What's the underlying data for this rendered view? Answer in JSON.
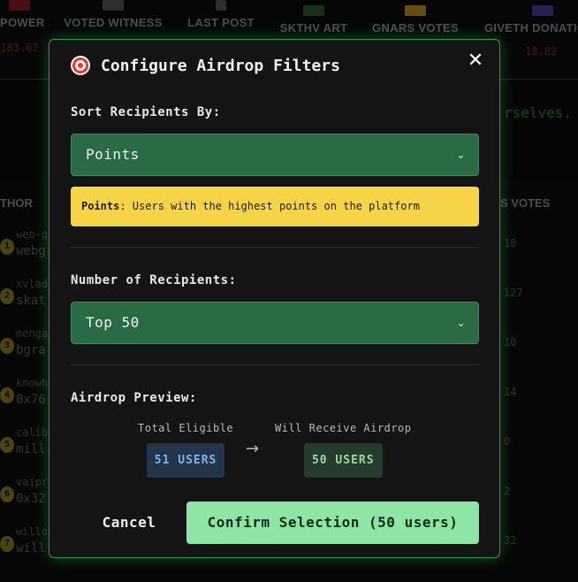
{
  "background": {
    "columns": [
      {
        "title": "POWER",
        "value": "183.62",
        "icon_color": "#8a1a1a"
      },
      {
        "title": "VOTED WITNESS",
        "value": "",
        "icon_color": "#555555"
      },
      {
        "title": "LAST POST",
        "value": "",
        "icon_color": "#555555"
      },
      {
        "title": "SKTHV ART",
        "value": "",
        "icon_color": "#2a5a2a"
      },
      {
        "title": "GNARS VOTES",
        "value": "",
        "icon_color": "#c08a20"
      },
      {
        "title": "GIVETH DONATIO",
        "value": "18.82",
        "icon_color": "#4a3a9a"
      }
    ],
    "banner_text": "rselves.",
    "table_headers": {
      "author": "THOR",
      "votes": "S VOTES"
    },
    "rows": [
      {
        "rank": "1",
        "name1": "web-g",
        "name2": "webg",
        "votes": "18",
        "red": false
      },
      {
        "rank": "2",
        "name1": "xvlad",
        "name2": "skat",
        "votes": "127",
        "red": false
      },
      {
        "rank": "3",
        "name1": "menga",
        "name2": "bgra",
        "votes": "10",
        "red": false
      },
      {
        "rank": "4",
        "name1": "knowh",
        "name2": "0x76",
        "votes": "14",
        "red": false
      },
      {
        "rank": "5",
        "name1": "calib",
        "name2": "mill",
        "votes": "0",
        "red": true
      },
      {
        "rank": "6",
        "name1": "vaipr",
        "name2": "0x32",
        "votes": "2",
        "red": false
      },
      {
        "rank": "7",
        "name1": "willo",
        "name2": "will",
        "votes": "32",
        "red": false
      }
    ]
  },
  "modal": {
    "title": "Configure Airdrop Filters",
    "title_icon": "target-icon",
    "close_glyph": "✕",
    "sort": {
      "label": "Sort Recipients By:",
      "selected": "Points"
    },
    "info": {
      "term": "Points",
      "description": ": Users with the highest points on the platform"
    },
    "recipients": {
      "label": "Number of Recipients:",
      "selected": "Top 50"
    },
    "preview": {
      "label": "Airdrop Preview:",
      "total_label": "Total Eligible",
      "total_value": "51 USERS",
      "receive_label": "Will Receive Airdrop",
      "receive_value": "50 USERS",
      "arrow": "→"
    },
    "buttons": {
      "cancel": "Cancel",
      "confirm": "Confirm Selection (50 users)"
    }
  },
  "colors": {
    "accent_green": "#2a9a4a",
    "select_bg": "#2a6a45",
    "info_yellow": "#f5d547",
    "confirm_bg": "#8ee6a6"
  }
}
